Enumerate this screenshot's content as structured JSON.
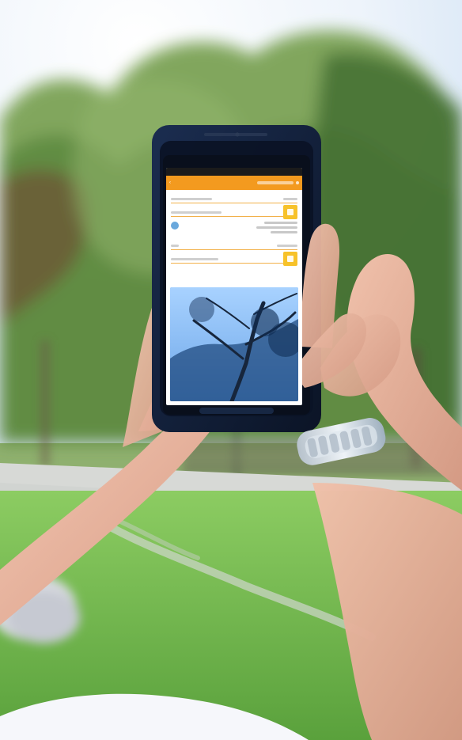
{
  "image": {
    "description": "",
    "colors": {
      "sky": "#eef4fb",
      "foliage_dark": "#3f6c2f",
      "foliage_mid": "#6f9a3e",
      "foliage_light": "#a9c66f",
      "grass": "#6fb24a",
      "path": "#d7d9d6",
      "tablet": "#0f1d35",
      "skin": "#e8b9a2",
      "watch": "#c9d3dc",
      "app_orange": "#f39a1f",
      "app_yellow": "#f7c22a",
      "app_blue": "#6aa8dc"
    }
  },
  "tablet_ui": {
    "status_left": "",
    "status_right": ""
  }
}
